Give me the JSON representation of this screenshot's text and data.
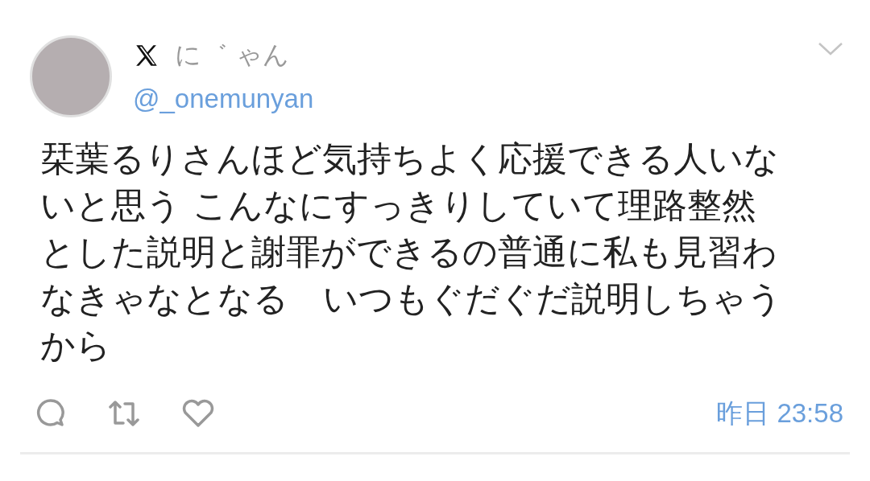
{
  "author": {
    "display_name": "に゛ ゃん",
    "handle": "@_onemunyan"
  },
  "body": "栞葉るりさんほど気持ちよく応援できる人いないと思う こんなにすっきりしていて理路整然とした説明と謝罪ができるの普通に私も見習わなきゃなとなる　いつもぐだぐだ説明しちゃうから",
  "timestamp": "昨日 23:58"
}
